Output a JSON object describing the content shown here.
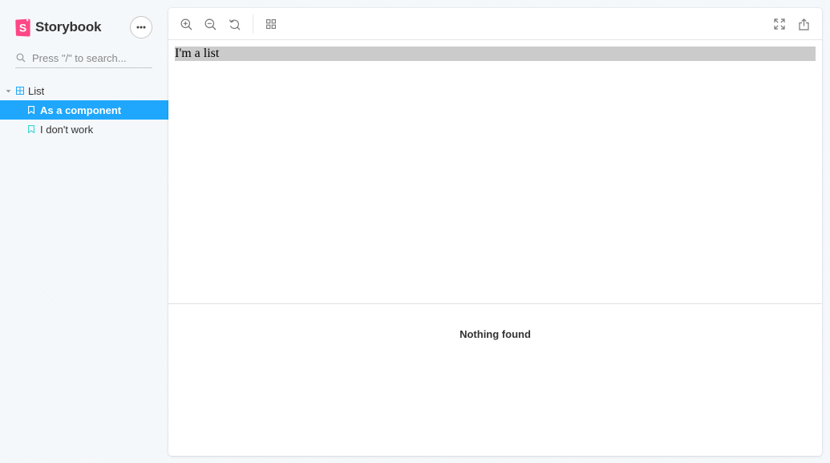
{
  "brand": {
    "name": "Storybook",
    "logo_letter": "S",
    "accent": "#ff4785"
  },
  "sidebar": {
    "menu_icon": "ellipsis-icon",
    "search": {
      "placeholder": "Press \"/\" to search...",
      "value": ""
    },
    "tree": [
      {
        "label": "List",
        "icon": "component-icon",
        "expanded": true,
        "stories": [
          {
            "label": "As a component",
            "icon": "bookmark-icon",
            "selected": true
          },
          {
            "label": "I don't work",
            "icon": "bookmark-icon",
            "selected": false
          }
        ]
      }
    ]
  },
  "toolbar": {
    "left_icons": [
      "zoom-in-icon",
      "zoom-out-icon",
      "zoom-reset-icon",
      "grid-icon"
    ],
    "right_icons": [
      "fullscreen-icon",
      "share-icon"
    ]
  },
  "preview": {
    "content_text": "I'm a list",
    "content_bg": "#cbcbcb"
  },
  "addons": {
    "empty_message": "Nothing found"
  },
  "colors": {
    "selection": "#1ea7fd",
    "icon_teal": "#37d5d3",
    "component_blue": "#1ea7fd"
  }
}
